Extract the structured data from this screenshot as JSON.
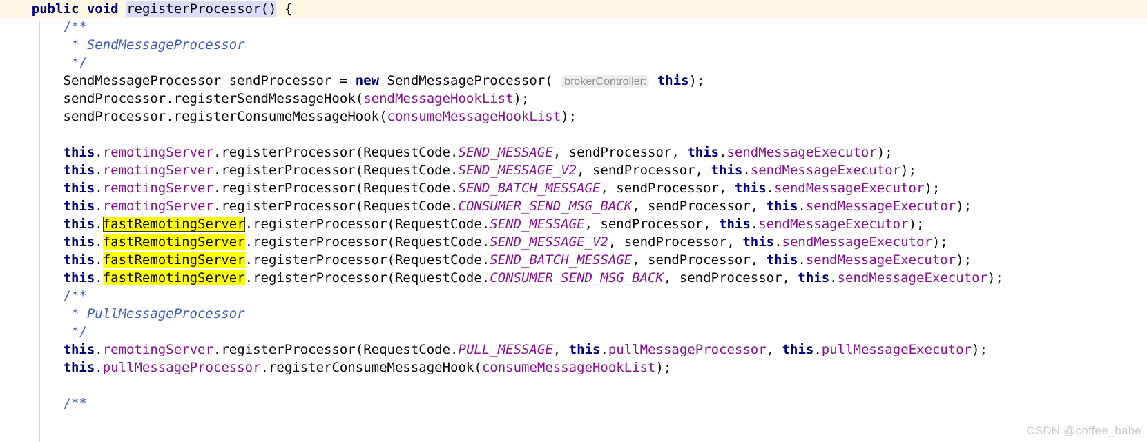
{
  "editor": {
    "language": "java",
    "colors": {
      "background": "#ffffff",
      "caret_line": "#fdf8e3",
      "keyword": "#000080",
      "field": "#871094",
      "comment": "#3f5fbf",
      "plain": "#0b0b0b",
      "occurrence_highlight": "#ffff00",
      "declaration_highlight": "#dcdcff",
      "inlay_hint_bg": "#eeeeee",
      "inlay_hint_fg": "#909090",
      "guide_line": "#d3d3d3",
      "watermark": "#c9c9c9"
    },
    "search_term": "fastRemotingServer",
    "lines": [
      {
        "n": 1,
        "caret": true,
        "tokens": [
          {
            "t": "    ",
            "c": "plain"
          },
          {
            "t": "public",
            "c": "kw"
          },
          {
            "t": " ",
            "c": "plain"
          },
          {
            "t": "void",
            "c": "kw"
          },
          {
            "t": " ",
            "c": "plain"
          },
          {
            "t": "registerProcessor()",
            "c": "plain decl-hl"
          },
          {
            "t": " {",
            "c": "plain"
          }
        ]
      },
      {
        "n": 2,
        "tokens": [
          {
            "t": "        ",
            "c": "plain"
          },
          {
            "t": "/**",
            "c": "cmtmark cmt-bg"
          }
        ]
      },
      {
        "n": 3,
        "tokens": [
          {
            "t": "         * ",
            "c": "cmtmark"
          },
          {
            "t": "SendMessageProcessor",
            "c": "cmt"
          }
        ]
      },
      {
        "n": 4,
        "tokens": [
          {
            "t": "         */",
            "c": "cmtmark"
          }
        ]
      },
      {
        "n": 5,
        "tokens": [
          {
            "t": "        SendMessageProcessor sendProcessor = ",
            "c": "plain"
          },
          {
            "t": "new",
            "c": "kw"
          },
          {
            "t": " SendMessageProcessor( ",
            "c": "plain"
          },
          {
            "t": "brokerController:",
            "c": "hint"
          },
          {
            "t": " ",
            "c": "plain"
          },
          {
            "t": "this",
            "c": "kw"
          },
          {
            "t": ");",
            "c": "plain"
          }
        ]
      },
      {
        "n": 6,
        "tokens": [
          {
            "t": "        sendProcessor.registerSendMessageHook(",
            "c": "plain"
          },
          {
            "t": "sendMessageHookList",
            "c": "field"
          },
          {
            "t": ");",
            "c": "plain"
          }
        ]
      },
      {
        "n": 7,
        "tokens": [
          {
            "t": "        sendProcessor.registerConsumeMessageHook(",
            "c": "plain"
          },
          {
            "t": "consumeMessageHookList",
            "c": "field"
          },
          {
            "t": ");",
            "c": "plain"
          }
        ]
      },
      {
        "n": 8,
        "tokens": []
      },
      {
        "n": 9,
        "tokens": [
          {
            "t": "        ",
            "c": "plain"
          },
          {
            "t": "this",
            "c": "kw"
          },
          {
            "t": ".",
            "c": "plain"
          },
          {
            "t": "remotingServer",
            "c": "field"
          },
          {
            "t": ".registerProcessor(RequestCode.",
            "c": "plain"
          },
          {
            "t": "SEND_MESSAGE",
            "c": "const"
          },
          {
            "t": ", sendProcessor, ",
            "c": "plain"
          },
          {
            "t": "this",
            "c": "kw"
          },
          {
            "t": ".",
            "c": "plain"
          },
          {
            "t": "sendMessageExecutor",
            "c": "field"
          },
          {
            "t": ");",
            "c": "plain"
          }
        ]
      },
      {
        "n": 10,
        "tokens": [
          {
            "t": "        ",
            "c": "plain"
          },
          {
            "t": "this",
            "c": "kw"
          },
          {
            "t": ".",
            "c": "plain"
          },
          {
            "t": "remotingServer",
            "c": "field"
          },
          {
            "t": ".registerProcessor(RequestCode.",
            "c": "plain"
          },
          {
            "t": "SEND_MESSAGE_V2",
            "c": "const"
          },
          {
            "t": ", sendProcessor, ",
            "c": "plain"
          },
          {
            "t": "this",
            "c": "kw"
          },
          {
            "t": ".",
            "c": "plain"
          },
          {
            "t": "sendMessageExecutor",
            "c": "field"
          },
          {
            "t": ");",
            "c": "plain"
          }
        ]
      },
      {
        "n": 11,
        "tokens": [
          {
            "t": "        ",
            "c": "plain"
          },
          {
            "t": "this",
            "c": "kw"
          },
          {
            "t": ".",
            "c": "plain"
          },
          {
            "t": "remotingServer",
            "c": "field"
          },
          {
            "t": ".registerProcessor(RequestCode.",
            "c": "plain"
          },
          {
            "t": "SEND_BATCH_MESSAGE",
            "c": "const"
          },
          {
            "t": ", sendProcessor, ",
            "c": "plain"
          },
          {
            "t": "this",
            "c": "kw"
          },
          {
            "t": ".",
            "c": "plain"
          },
          {
            "t": "sendMessageExecutor",
            "c": "field"
          },
          {
            "t": ");",
            "c": "plain"
          }
        ]
      },
      {
        "n": 12,
        "tokens": [
          {
            "t": "        ",
            "c": "plain"
          },
          {
            "t": "this",
            "c": "kw"
          },
          {
            "t": ".",
            "c": "plain"
          },
          {
            "t": "remotingServer",
            "c": "field"
          },
          {
            "t": ".registerProcessor(RequestCode.",
            "c": "plain"
          },
          {
            "t": "CONSUMER_SEND_MSG_BACK",
            "c": "const"
          },
          {
            "t": ", sendProcessor, ",
            "c": "plain"
          },
          {
            "t": "this",
            "c": "kw"
          },
          {
            "t": ".",
            "c": "plain"
          },
          {
            "t": "sendMessageExecutor",
            "c": "field"
          },
          {
            "t": ");",
            "c": "plain"
          }
        ]
      },
      {
        "n": 13,
        "tokens": [
          {
            "t": "        ",
            "c": "plain"
          },
          {
            "t": "this",
            "c": "kw"
          },
          {
            "t": ".",
            "c": "plain"
          },
          {
            "t": "fastRemotingServer",
            "c": "occ-current"
          },
          {
            "t": ".registerProcessor(RequestCode.",
            "c": "plain"
          },
          {
            "t": "SEND_MESSAGE",
            "c": "const"
          },
          {
            "t": ", sendProcessor, ",
            "c": "plain"
          },
          {
            "t": "this",
            "c": "kw"
          },
          {
            "t": ".",
            "c": "plain"
          },
          {
            "t": "sendMessageExecutor",
            "c": "field"
          },
          {
            "t": ");",
            "c": "plain"
          }
        ]
      },
      {
        "n": 14,
        "tokens": [
          {
            "t": "        ",
            "c": "plain"
          },
          {
            "t": "this",
            "c": "kw"
          },
          {
            "t": ".",
            "c": "plain"
          },
          {
            "t": "fastRemotingServer",
            "c": "occ"
          },
          {
            "t": ".registerProcessor(RequestCode.",
            "c": "plain"
          },
          {
            "t": "SEND_MESSAGE_V2",
            "c": "const"
          },
          {
            "t": ", sendProcessor, ",
            "c": "plain"
          },
          {
            "t": "this",
            "c": "kw"
          },
          {
            "t": ".",
            "c": "plain"
          },
          {
            "t": "sendMessageExecutor",
            "c": "field"
          },
          {
            "t": ");",
            "c": "plain"
          }
        ]
      },
      {
        "n": 15,
        "tokens": [
          {
            "t": "        ",
            "c": "plain"
          },
          {
            "t": "this",
            "c": "kw"
          },
          {
            "t": ".",
            "c": "plain"
          },
          {
            "t": "fastRemotingServer",
            "c": "occ"
          },
          {
            "t": ".registerProcessor(RequestCode.",
            "c": "plain"
          },
          {
            "t": "SEND_BATCH_MESSAGE",
            "c": "const"
          },
          {
            "t": ", sendProcessor, ",
            "c": "plain"
          },
          {
            "t": "this",
            "c": "kw"
          },
          {
            "t": ".",
            "c": "plain"
          },
          {
            "t": "sendMessageExecutor",
            "c": "field"
          },
          {
            "t": ");",
            "c": "plain"
          }
        ]
      },
      {
        "n": 16,
        "tokens": [
          {
            "t": "        ",
            "c": "plain"
          },
          {
            "t": "this",
            "c": "kw"
          },
          {
            "t": ".",
            "c": "plain"
          },
          {
            "t": "fastRemotingServer",
            "c": "occ"
          },
          {
            "t": ".registerProcessor(RequestCode.",
            "c": "plain"
          },
          {
            "t": "CONSUMER_SEND_MSG_BACK",
            "c": "const"
          },
          {
            "t": ", sendProcessor, ",
            "c": "plain"
          },
          {
            "t": "this",
            "c": "kw"
          },
          {
            "t": ".",
            "c": "plain"
          },
          {
            "t": "sendMessageExecutor",
            "c": "field"
          },
          {
            "t": ");",
            "c": "plain"
          }
        ]
      },
      {
        "n": 17,
        "tokens": [
          {
            "t": "        ",
            "c": "plain"
          },
          {
            "t": "/**",
            "c": "cmtmark cmt-bg"
          }
        ]
      },
      {
        "n": 18,
        "tokens": [
          {
            "t": "         * ",
            "c": "cmtmark"
          },
          {
            "t": "PullMessageProcessor",
            "c": "cmt"
          }
        ]
      },
      {
        "n": 19,
        "tokens": [
          {
            "t": "         */",
            "c": "cmtmark"
          }
        ]
      },
      {
        "n": 20,
        "tokens": [
          {
            "t": "        ",
            "c": "plain"
          },
          {
            "t": "this",
            "c": "kw"
          },
          {
            "t": ".",
            "c": "plain"
          },
          {
            "t": "remotingServer",
            "c": "field"
          },
          {
            "t": ".registerProcessor(RequestCode.",
            "c": "plain"
          },
          {
            "t": "PULL_MESSAGE",
            "c": "const"
          },
          {
            "t": ", ",
            "c": "plain"
          },
          {
            "t": "this",
            "c": "kw"
          },
          {
            "t": ".",
            "c": "plain"
          },
          {
            "t": "pullMessageProcessor",
            "c": "field"
          },
          {
            "t": ", ",
            "c": "plain"
          },
          {
            "t": "this",
            "c": "kw"
          },
          {
            "t": ".",
            "c": "plain"
          },
          {
            "t": "pullMessageExecutor",
            "c": "field"
          },
          {
            "t": ");",
            "c": "plain"
          }
        ]
      },
      {
        "n": 21,
        "tokens": [
          {
            "t": "        ",
            "c": "plain"
          },
          {
            "t": "this",
            "c": "kw"
          },
          {
            "t": ".",
            "c": "plain"
          },
          {
            "t": "pullMessageProcessor",
            "c": "field"
          },
          {
            "t": ".registerConsumeMessageHook(",
            "c": "plain"
          },
          {
            "t": "consumeMessageHookList",
            "c": "field"
          },
          {
            "t": ");",
            "c": "plain"
          }
        ]
      },
      {
        "n": 22,
        "tokens": []
      },
      {
        "n": 23,
        "tokens": [
          {
            "t": "        ",
            "c": "plain"
          },
          {
            "t": "/**",
            "c": "cmtmark cmt-bg"
          }
        ]
      }
    ]
  },
  "watermark": {
    "text": "CSDN @coffee_babe"
  }
}
